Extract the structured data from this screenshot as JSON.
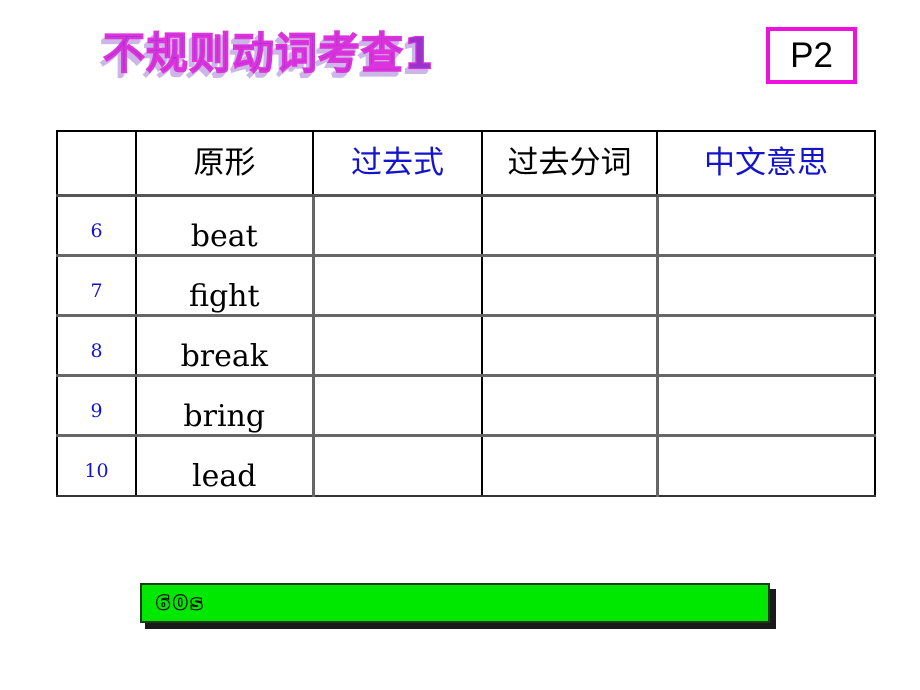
{
  "slide": {
    "title": "不规则动词考查1",
    "page_badge": "P2",
    "accent_magenta": "#EE11DD",
    "accent_blue": "#1414CC",
    "accent_purple": "#9933CC",
    "timer_green": "#00E800"
  },
  "table": {
    "headers": {
      "index": "",
      "base_form": "原形",
      "past_tense": "过去式",
      "past_participle": "过去分词",
      "chinese_meaning": "中文意思"
    },
    "rows": [
      {
        "num": "6",
        "verb": "beat",
        "past": "",
        "participle": "",
        "meaning": ""
      },
      {
        "num": "7",
        "verb": "fight",
        "past": "",
        "participle": "",
        "meaning": ""
      },
      {
        "num": "8",
        "verb": "break",
        "past": "",
        "participle": "",
        "meaning": ""
      },
      {
        "num": "9",
        "verb": "bring",
        "past": "",
        "participle": "",
        "meaning": ""
      },
      {
        "num": "10",
        "verb": "lead",
        "past": "",
        "participle": "",
        "meaning": ""
      }
    ]
  },
  "timer": {
    "label": "60s",
    "fill_percent": 100
  }
}
